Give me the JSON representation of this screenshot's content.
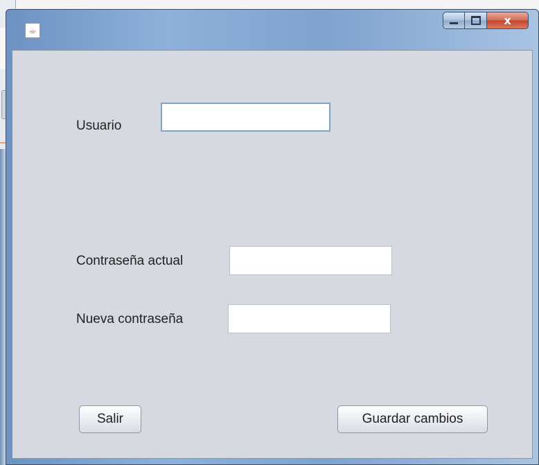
{
  "window": {
    "icon": "java-cup-icon",
    "buttons": {
      "minimize": "minimize-icon",
      "maximize": "maximize-icon",
      "close": "x"
    }
  },
  "form": {
    "usuario_label": "Usuario",
    "usuario_value": "",
    "current_password_label": "Contraseña actual",
    "current_password_value": "",
    "new_password_label": "Nueva contraseña",
    "new_password_value": ""
  },
  "actions": {
    "exit_label": "Salir",
    "save_label": "Guardar cambios"
  }
}
